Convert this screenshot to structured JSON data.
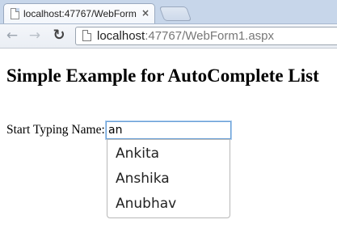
{
  "browser": {
    "tab": {
      "title": "localhost:47767/WebForm",
      "close_glyph": "×",
      "favicon": "page-icon"
    },
    "nav": {
      "back_glyph": "←",
      "forward_glyph": "→",
      "reload_glyph": "↻"
    },
    "address": {
      "host": "localhost",
      "rest": ":47767/WebForm1.aspx",
      "icon": "page-icon"
    }
  },
  "page": {
    "heading": "Simple Example for AutoComplete List",
    "form": {
      "label": "Start Typing Name:",
      "input_value": "an"
    },
    "autocomplete": {
      "items": [
        "Ankita",
        "Anshika",
        "Anubhav"
      ]
    }
  },
  "colors": {
    "tabstrip": "#c7d6ea",
    "input_focus_border": "#6aa0d6",
    "suggestion_border": "#b8b8b8"
  }
}
